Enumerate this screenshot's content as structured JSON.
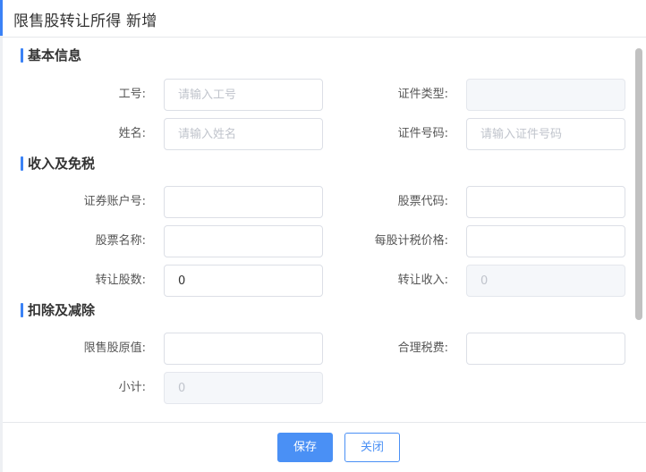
{
  "dialog": {
    "title": "限售股转让所得 新增"
  },
  "sections": {
    "basic": {
      "title": "基本信息",
      "employee_id": {
        "label": "工号:",
        "placeholder": "请输入工号",
        "value": ""
      },
      "id_type": {
        "label": "证件类型:",
        "value": ""
      },
      "name": {
        "label": "姓名:",
        "placeholder": "请输入姓名",
        "value": ""
      },
      "id_number": {
        "label": "证件号码:",
        "placeholder": "请输入证件号码",
        "value": ""
      }
    },
    "income": {
      "title": "收入及免税",
      "securities_account": {
        "label": "证券账户号:",
        "value": ""
      },
      "stock_code": {
        "label": "股票代码:",
        "value": ""
      },
      "stock_name": {
        "label": "股票名称:",
        "value": ""
      },
      "tax_price_per_share": {
        "label": "每股计税价格:",
        "value": ""
      },
      "shares_transferred": {
        "label": "转让股数:",
        "value": "0"
      },
      "transfer_income": {
        "label": "转让收入:",
        "value": "0"
      }
    },
    "deduction": {
      "title": "扣除及减除",
      "original_value": {
        "label": "限售股原值:",
        "value": ""
      },
      "reasonable_taxes": {
        "label": "合理税费:",
        "value": ""
      },
      "subtotal": {
        "label": "小计:",
        "value": "0"
      }
    }
  },
  "footer": {
    "save_label": "保存",
    "close_label": "关闭"
  },
  "colors": {
    "accent": "#4a90f5",
    "section_bar": "#3b82f6",
    "disabled_bg": "#f5f7fa",
    "border": "#dcdfe6"
  }
}
